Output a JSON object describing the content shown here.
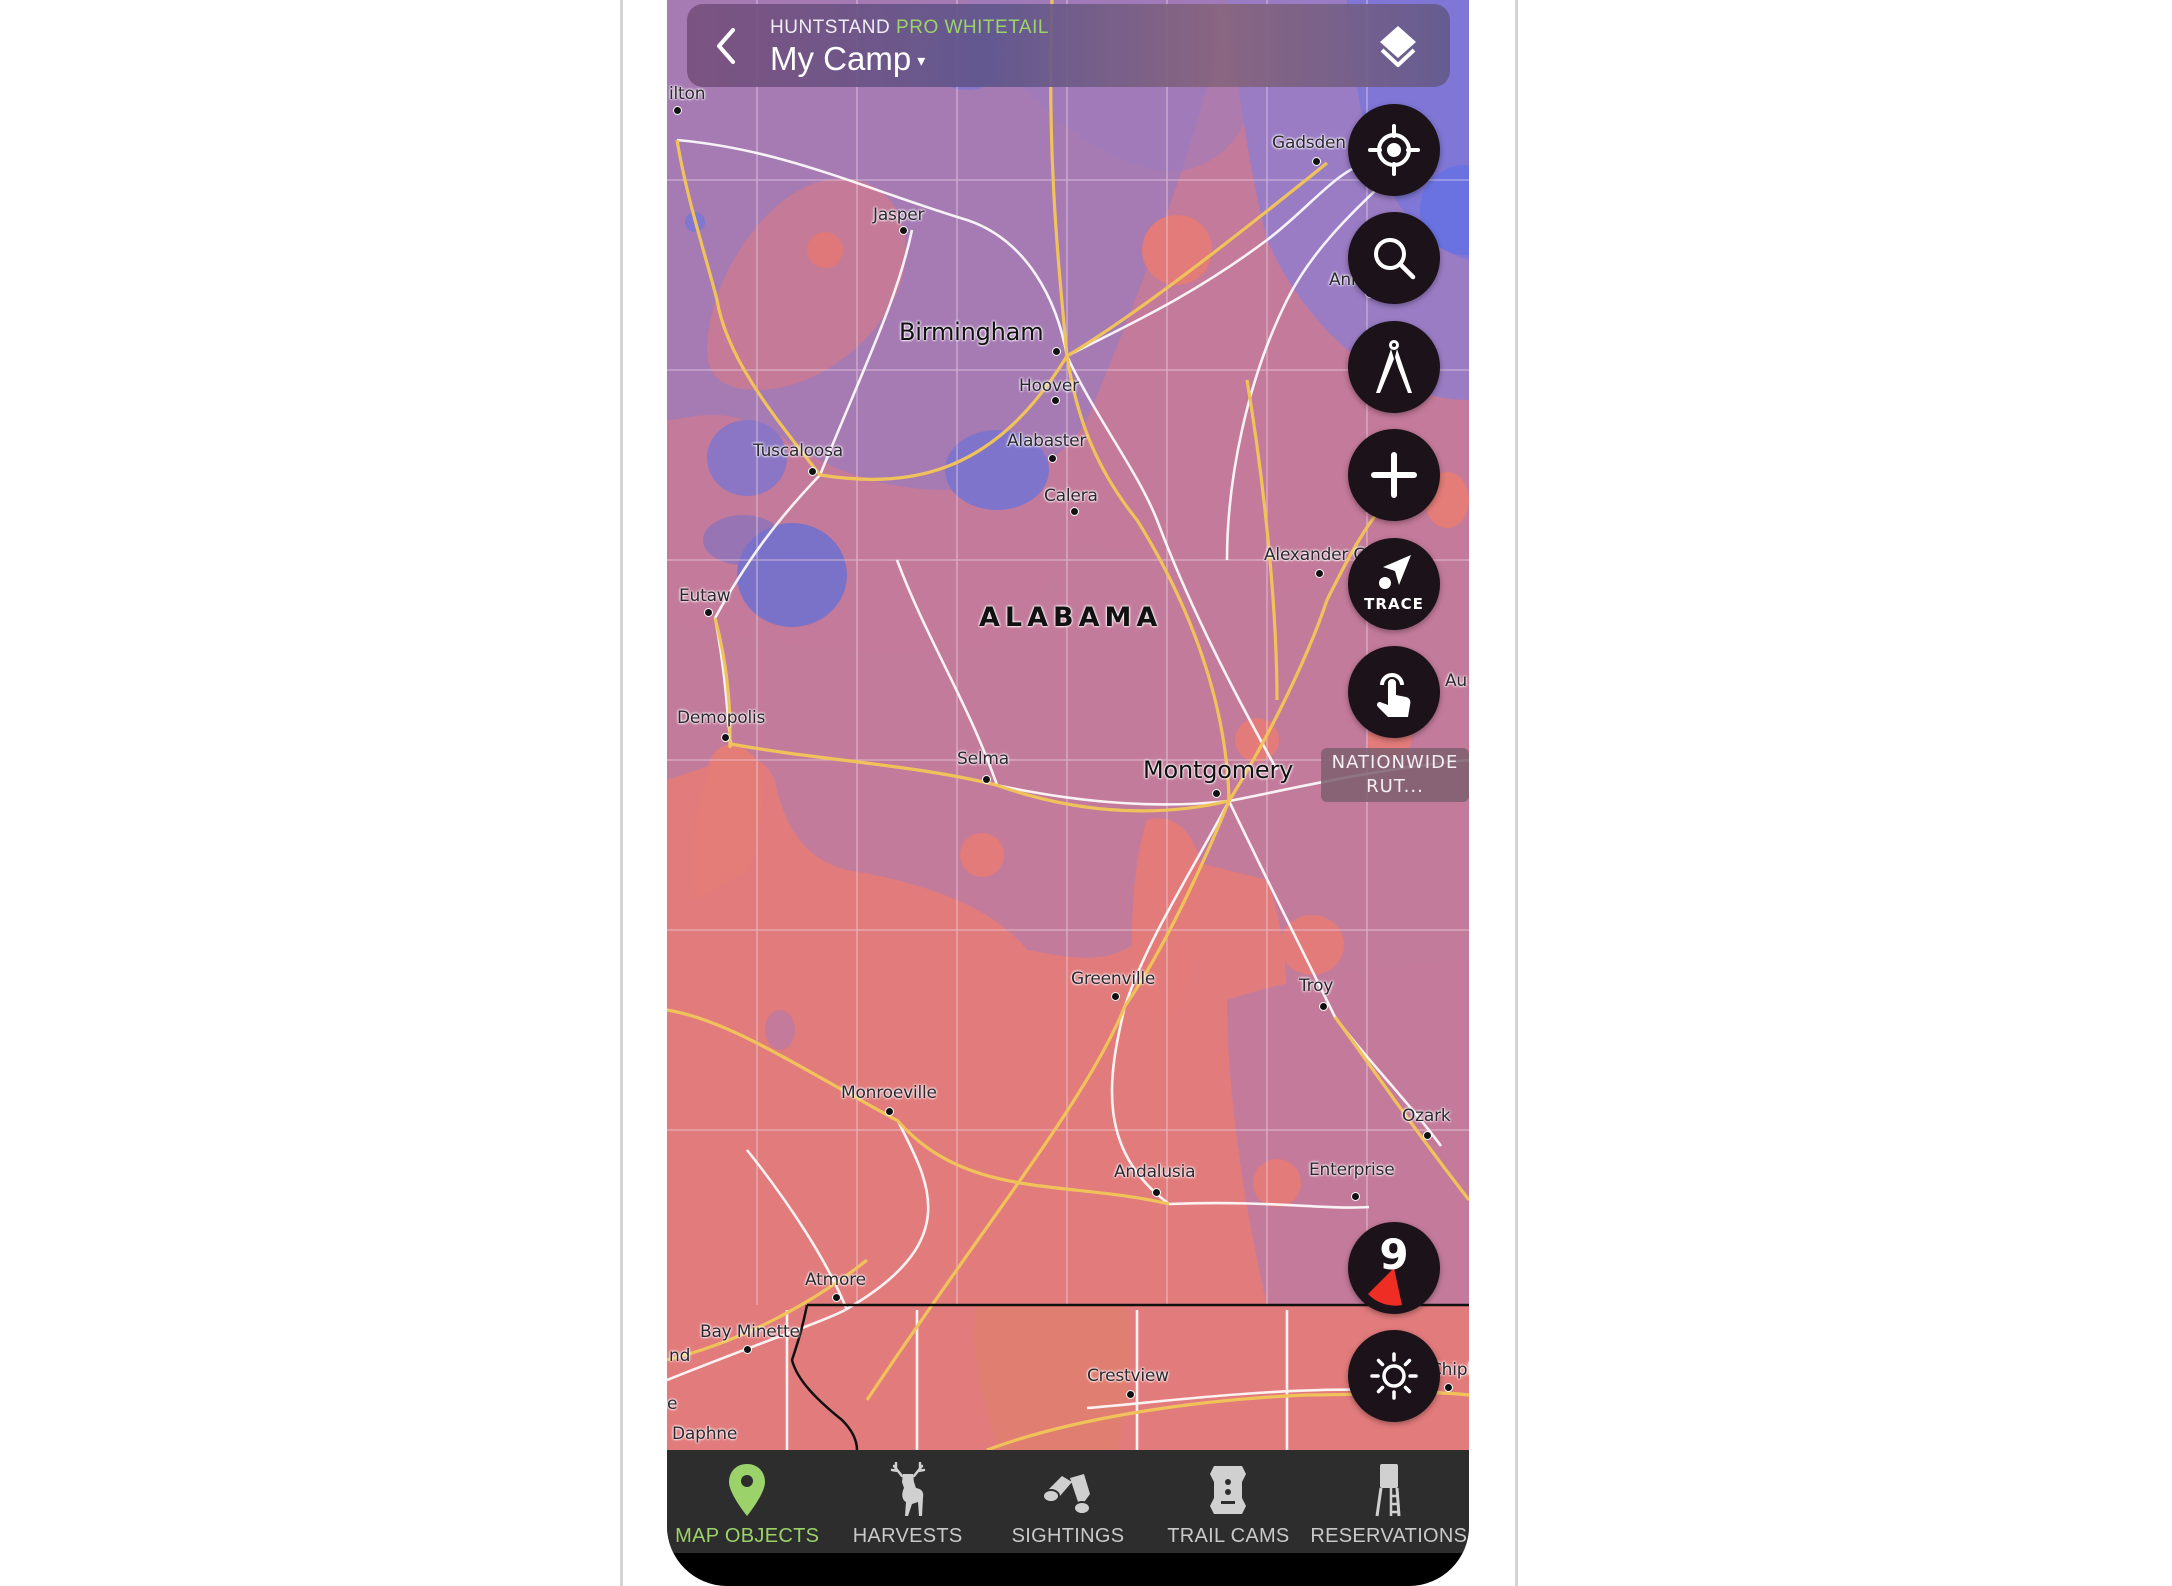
{
  "header": {
    "brand": "HUNTSTAND",
    "brand_tier": "PRO WHITETAIL",
    "camp_name": "My Camp",
    "camp_caret": "▾",
    "back_icon": "chevron-left-icon",
    "layers_icon": "layers-icon"
  },
  "colors": {
    "accent_green": "#9bd36a",
    "button_bg": "#1c1219",
    "tabbar_bg": "#2d2d2d",
    "compass_wedge": "#ee2e24"
  },
  "map_controls": {
    "locate": {
      "icon": "crosshair-locate-icon"
    },
    "search": {
      "icon": "search-icon"
    },
    "measure": {
      "icon": "compass-divider-icon"
    },
    "add": {
      "icon": "plus-icon"
    },
    "trace": {
      "icon": "trace-arrow-icon",
      "label": "TRACE"
    },
    "touch": {
      "icon": "tap-finger-icon"
    },
    "layer_badge": {
      "line1": "NATIONWIDE",
      "line2": "RUT..."
    },
    "wind_compass": {
      "value": "9"
    },
    "brightness": {
      "icon": "sun-icon"
    }
  },
  "map": {
    "state_label": "ALABAMA",
    "cities": {
      "hamilton": "ilton",
      "jasper": "Jasper",
      "birmingham": "Birmingham",
      "hoover": "Hoover",
      "alabaster": "Alabaster",
      "calera": "Calera",
      "tuscaloosa": "Tuscaloosa",
      "gadsden": "Gadsden",
      "anniston": "Anniston",
      "eutaw": "Eutaw",
      "alexander_city": "Alexander City",
      "auburn": "Au",
      "demopolis": "Demopolis",
      "selma": "Selma",
      "montgomery": "Montgomery",
      "greenville": "Greenville",
      "troy": "Troy",
      "monroeville": "Monroeville",
      "ozark": "Ozark",
      "andalusia": "Andalusia",
      "enterprise": "Enterprise",
      "atmore": "Atmore",
      "bay_minette": "Bay Minette",
      "island_partial": "nd",
      "e_partial": "e",
      "daphne": "Daphne",
      "crestview": "Crestview",
      "chipley": "Chipl"
    }
  },
  "tabs": [
    {
      "label": "MAP OBJECTS",
      "icon": "map-pin-icon",
      "active": true
    },
    {
      "label": "HARVESTS",
      "icon": "deer-icon",
      "active": false
    },
    {
      "label": "SIGHTINGS",
      "icon": "binoculars-icon",
      "active": false
    },
    {
      "label": "TRAIL CAMS",
      "icon": "trail-camera-icon",
      "active": false
    },
    {
      "label": "RESERVATIONS",
      "icon": "tree-stand-icon",
      "active": false
    }
  ]
}
